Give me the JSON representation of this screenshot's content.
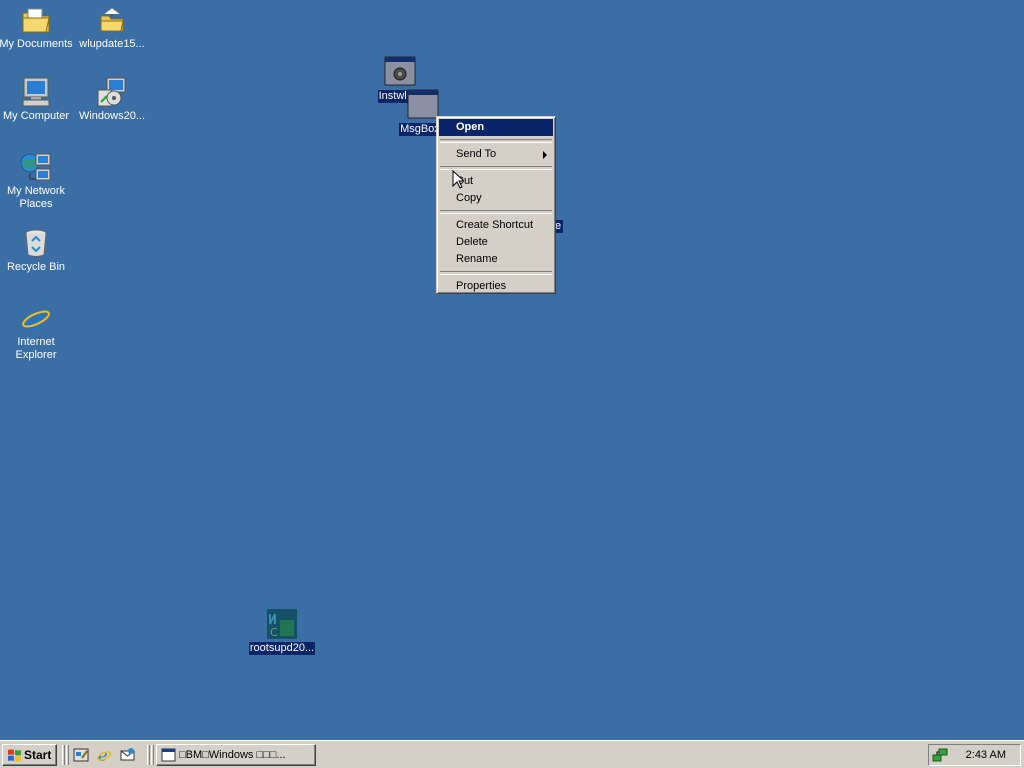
{
  "desktop": {
    "background": "#3a6ea5",
    "selection_color": "#0a246a",
    "icons": [
      {
        "label": "My Documents",
        "icon": "folder-documents-icon"
      },
      {
        "label": "wlupdate15...",
        "icon": "folder-icon"
      },
      {
        "label": "My Computer",
        "icon": "computer-icon"
      },
      {
        "label": "Windows20...",
        "icon": "installer-icon"
      },
      {
        "label": "My Network Places",
        "icon": "network-icon"
      },
      {
        "label": "Recycle Bin",
        "icon": "recycle-bin-icon"
      },
      {
        "label": "Internet Explorer",
        "icon": "internet-explorer-icon"
      },
      {
        "label": "Instwlu.c",
        "icon": "gear-program-icon",
        "selected": true
      },
      {
        "label": "MsgBox2",
        "icon": "window-program-icon",
        "selected": true
      },
      {
        "label": "e",
        "icon": "selected-label-fragment",
        "selected": true
      },
      {
        "label": "rootsupd20...",
        "icon": "rootsupd-icon",
        "selected": true
      }
    ]
  },
  "context_menu": {
    "items": [
      {
        "label": "Open",
        "default": true,
        "highlighted": true
      },
      {
        "label": "Send To",
        "submenu": true
      },
      {
        "label": "Cut"
      },
      {
        "label": "Copy"
      },
      {
        "label": "Create Shortcut"
      },
      {
        "label": "Delete"
      },
      {
        "label": "Rename"
      },
      {
        "label": "Properties"
      }
    ]
  },
  "taskbar": {
    "start_label": "Start",
    "quick_launch": [
      "show-desktop-icon",
      "internet-explorer-icon",
      "outlook-express-icon"
    ],
    "task_button_label": "□BM□Windows □□□...",
    "clock": "2:43 AM",
    "tray_icon": "network-tray-icon"
  }
}
